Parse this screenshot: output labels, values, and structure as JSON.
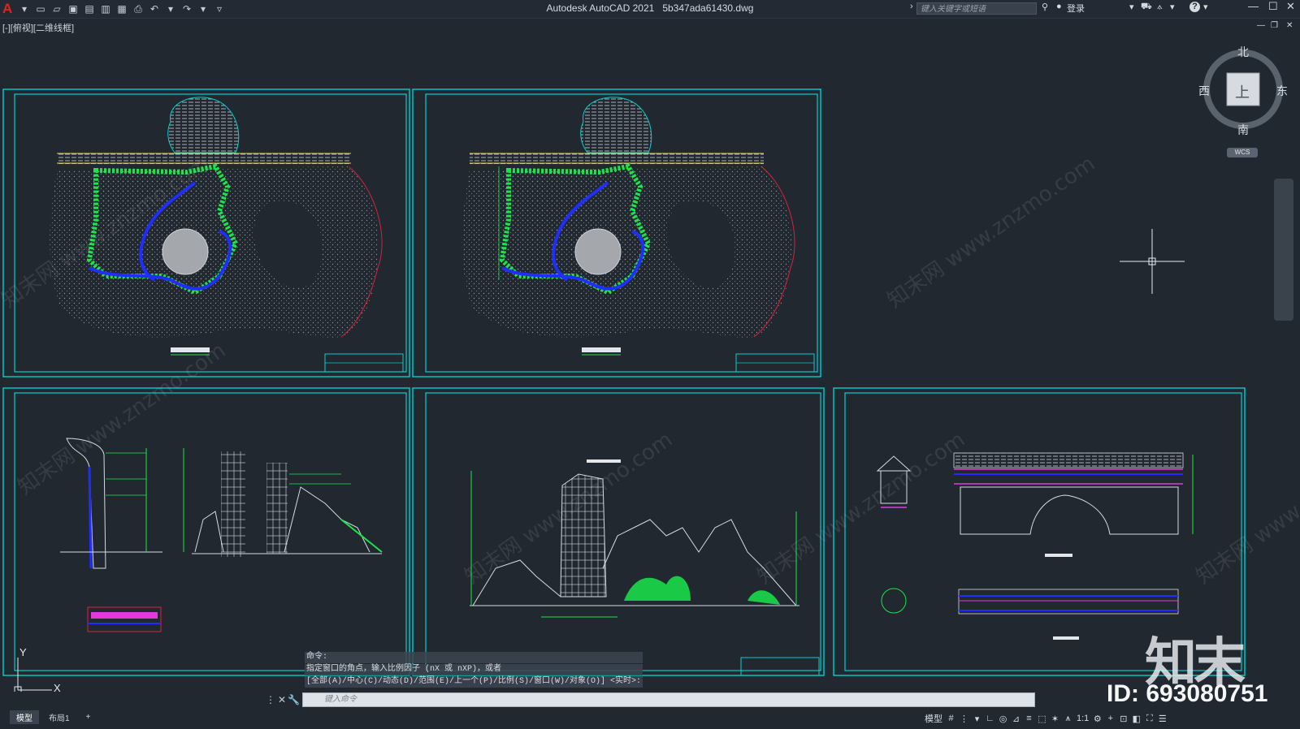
{
  "app": {
    "title": "Autodesk AutoCAD 2021",
    "filename": "5b347ada61430.dwg",
    "viewport_label": "[-][俯视][二维线框]",
    "search_placeholder": "键入关键字或短语",
    "login": "登录",
    "help": "?",
    "accent": "#e2231a"
  },
  "viewcube": {
    "north": "北",
    "south": "南",
    "east": "东",
    "west": "西",
    "face": "上",
    "wcs": "WCS"
  },
  "command": {
    "history": [
      "命令:",
      "指定窗口的角点，输入比例因子 (nX 或 nXP)，或者",
      "[全部(A)/中心(C)/动态(D)/范围(E)/上一个(P)/比例(S)/窗口(W)/对象(O)] <实时>:"
    ],
    "input_placeholder": "键入命令"
  },
  "tabs": [
    "模型",
    "布局1",
    "+"
  ],
  "status": {
    "model": "模型",
    "scale": "1:1"
  },
  "axes": {
    "x": "X",
    "y": "Y"
  },
  "watermark": {
    "logo": "知末",
    "id": "ID: 693080751",
    "diagonal_text": "知末网 www.znzmo.com"
  },
  "colors": {
    "background": "#212830",
    "frame": "#00cfd1",
    "vegetation": "#19e64a",
    "water": "#1f2eff",
    "accent_line": "#e3d24a",
    "red_edge": "#d9213d",
    "magenta": "#e03ad8"
  }
}
